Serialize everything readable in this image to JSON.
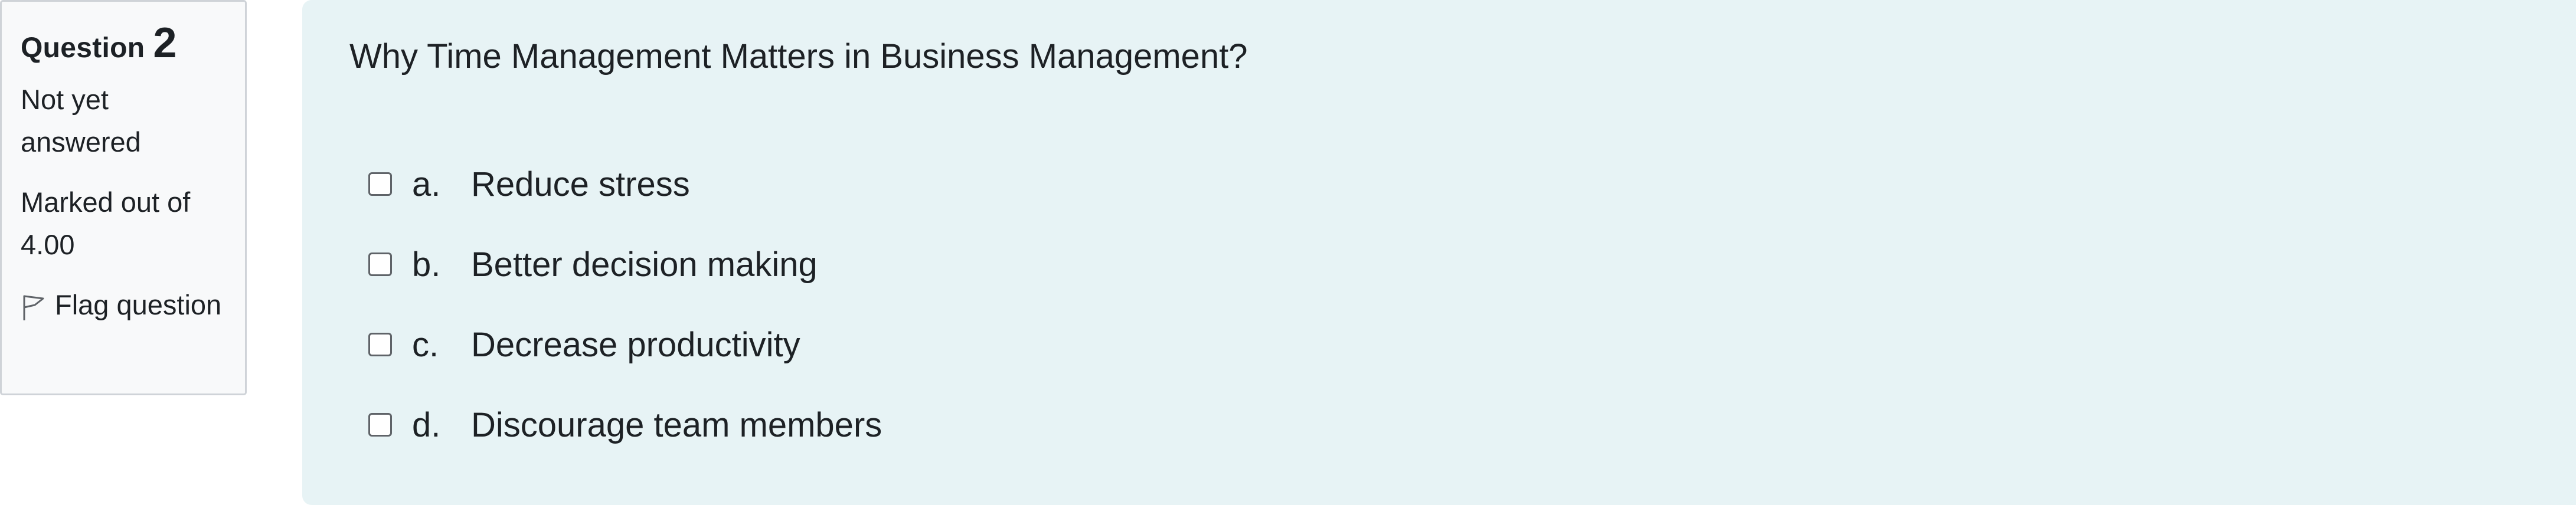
{
  "info": {
    "question_label": "Question",
    "question_number": "2",
    "state": "Not yet answered",
    "grade": "Marked out of 4.00",
    "flag_label": "Flag question",
    "flag_icon": "flag-outline-icon"
  },
  "question": {
    "text": "Why Time Management Matters in Business Management?",
    "answers": [
      {
        "letter": "a.",
        "text": "Reduce stress",
        "checked": false
      },
      {
        "letter": "b.",
        "text": "Better decision making",
        "checked": false
      },
      {
        "letter": "c.",
        "text": "Decrease productivity",
        "checked": false
      },
      {
        "letter": "d.",
        "text": "Discourage team members",
        "checked": false
      }
    ]
  },
  "colors": {
    "info_bg": "#f8f9fa",
    "info_border": "#cfd3d8",
    "content_bg": "#e7f3f5",
    "text": "#1d2125"
  }
}
